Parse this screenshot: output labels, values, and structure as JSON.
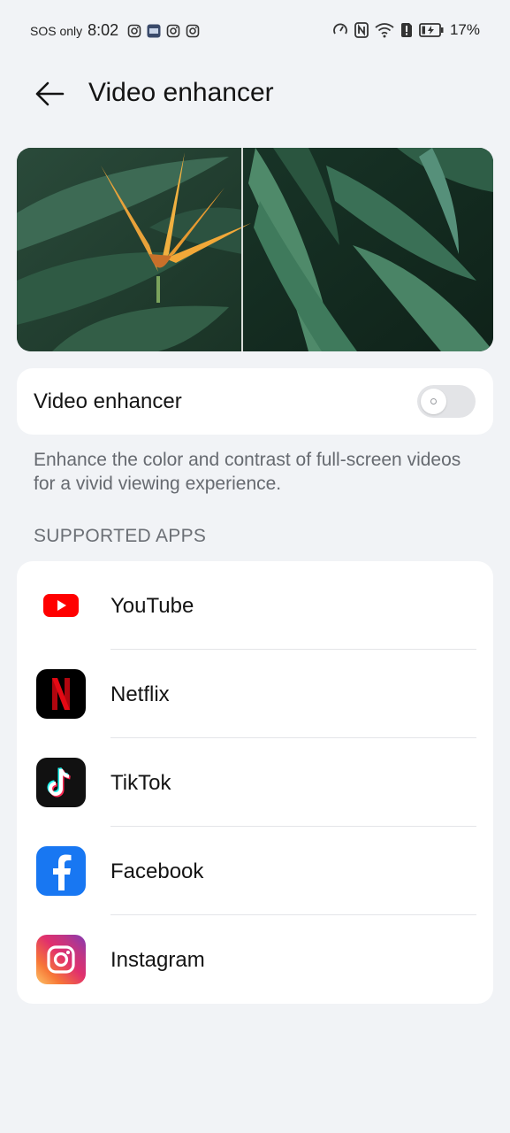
{
  "status_bar": {
    "carrier": "SOS only",
    "time": "8:02",
    "battery": "17%"
  },
  "header": {
    "title": "Video enhancer"
  },
  "toggle": {
    "label": "Video enhancer",
    "state": "off"
  },
  "description": "Enhance the color and contrast of full-screen videos for a vivid viewing experience.",
  "section": {
    "title": "SUPPORTED APPS"
  },
  "apps": [
    {
      "name": "YouTube",
      "icon": "youtube-icon"
    },
    {
      "name": "Netflix",
      "icon": "netflix-icon"
    },
    {
      "name": "TikTok",
      "icon": "tiktok-icon"
    },
    {
      "name": "Facebook",
      "icon": "facebook-icon"
    },
    {
      "name": "Instagram",
      "icon": "instagram-icon"
    }
  ],
  "colors": {
    "background": "#f1f3f6",
    "card": "#ffffff",
    "youtube": "#ff0000",
    "facebook": "#1877f2"
  }
}
